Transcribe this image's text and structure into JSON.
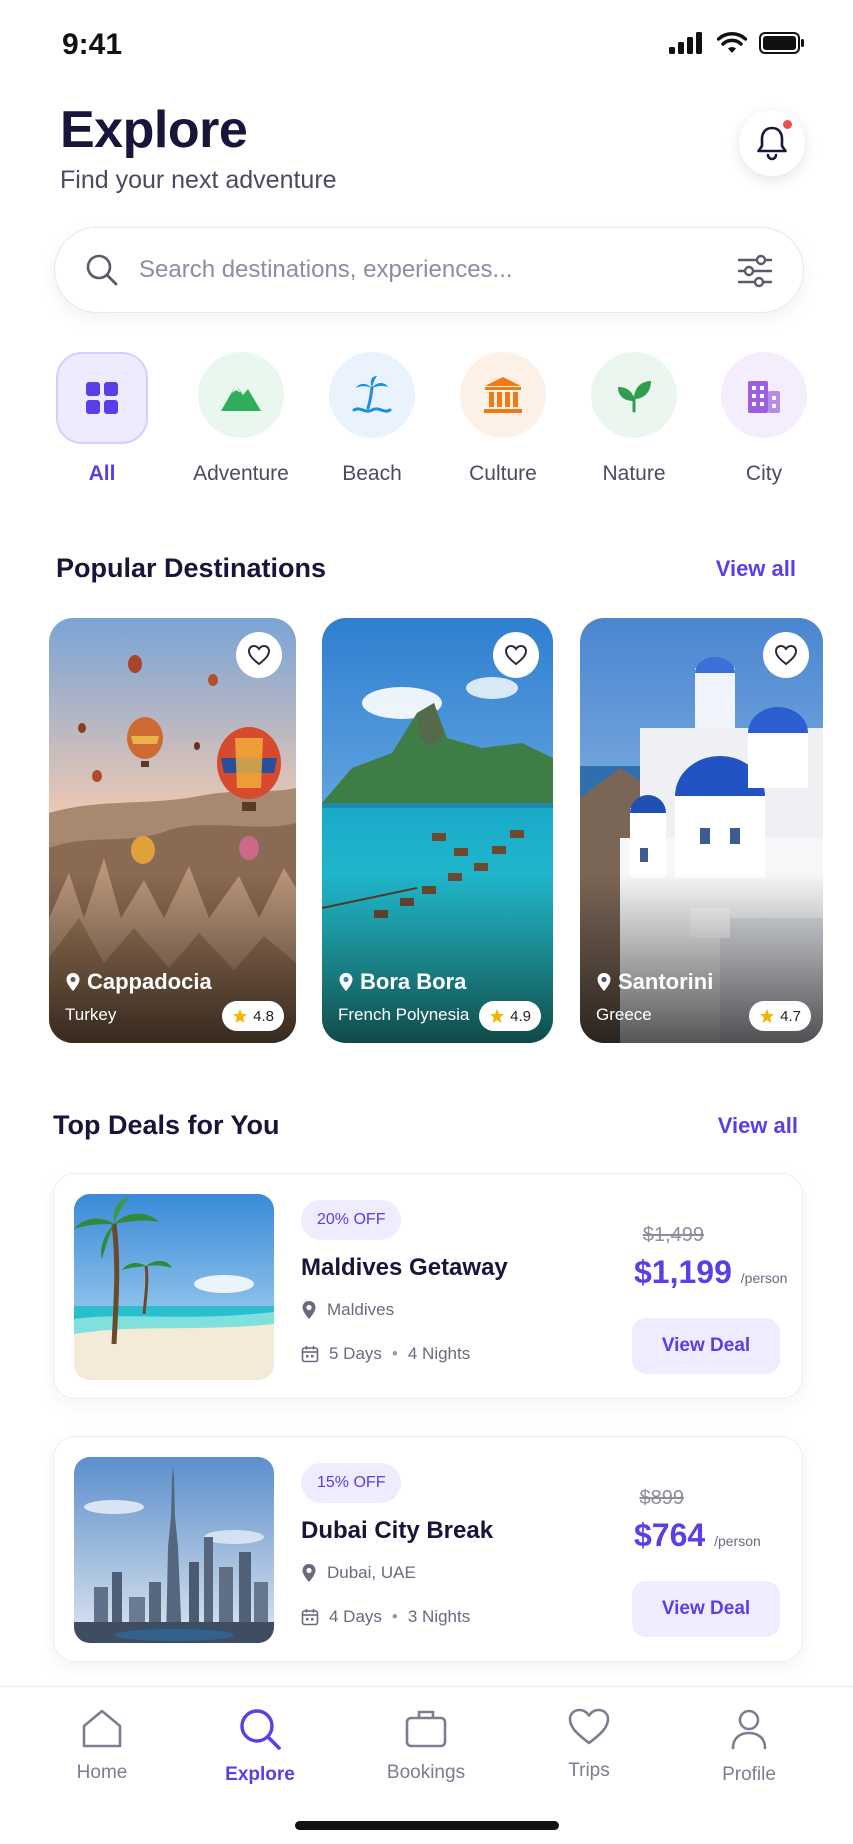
{
  "status": {
    "time": "9:41"
  },
  "header": {
    "title": "Explore",
    "subtitle": "Find your next adventure"
  },
  "search": {
    "placeholder": "Search destinations, experiences..."
  },
  "categories": [
    {
      "label": "All",
      "icon": "grid-icon",
      "active": true
    },
    {
      "label": "Adventure",
      "icon": "mountain-icon"
    },
    {
      "label": "Beach",
      "icon": "palm-tree-icon"
    },
    {
      "label": "Culture",
      "icon": "museum-icon"
    },
    {
      "label": "Nature",
      "icon": "leaf-icon"
    },
    {
      "label": "City",
      "icon": "building-icon"
    }
  ],
  "popular": {
    "title": "Popular Destinations",
    "view_all": "View all",
    "cards": [
      {
        "name": "Cappadocia",
        "country": "Turkey",
        "rating": "4.8"
      },
      {
        "name": "Bora Bora",
        "country": "French Polynesia",
        "rating": "4.9"
      },
      {
        "name": "Santorini",
        "country": "Greece",
        "rating": "4.7"
      }
    ]
  },
  "deals": {
    "title": "Top Deals for You",
    "view_all": "View all",
    "items": [
      {
        "badge": "20% OFF",
        "title": "Maldives Getaway",
        "location": "Maldives",
        "days": "5 Days",
        "nights": "4 Nights",
        "old_price": "$1,499",
        "price": "$1,199",
        "per": "/person",
        "button": "View Deal"
      },
      {
        "badge": "15% OFF",
        "title": "Dubai City Break",
        "location": "Dubai, UAE",
        "days": "4 Days",
        "nights": "3 Nights",
        "old_price": "$899",
        "price": "$764",
        "per": "/person",
        "button": "View Deal"
      }
    ]
  },
  "nav": [
    {
      "label": "Home",
      "icon": "home-icon"
    },
    {
      "label": "Explore",
      "icon": "search-icon",
      "active": true
    },
    {
      "label": "Bookings",
      "icon": "briefcase-icon"
    },
    {
      "label": "Trips",
      "icon": "heart-icon"
    },
    {
      "label": "Profile",
      "icon": "user-icon"
    }
  ],
  "colors": {
    "accent": "#5b3ee6",
    "notification": "#f04b4b",
    "star": "#f5b400"
  }
}
